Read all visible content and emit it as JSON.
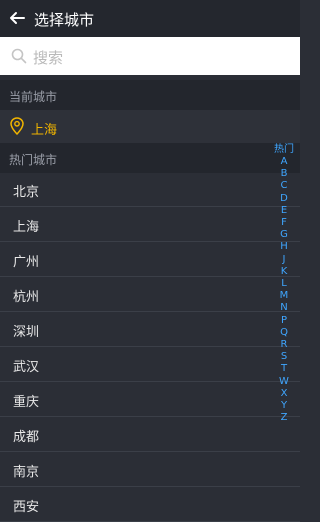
{
  "header": {
    "title": "选择城市",
    "back_icon": "arrow-left-icon"
  },
  "search": {
    "placeholder": "搜索",
    "icon": "search-icon"
  },
  "current_section": {
    "header": "当前城市",
    "city": "上海",
    "icon": "location-pin-icon"
  },
  "hot_section": {
    "header": "热门城市"
  },
  "cities": [
    "北京",
    "上海",
    "广州",
    "杭州",
    "深圳",
    "武汉",
    "重庆",
    "成都",
    "南京",
    "西安"
  ],
  "index": [
    "热门",
    "A",
    "B",
    "C",
    "D",
    "E",
    "F",
    "G",
    "H",
    "J",
    "K",
    "L",
    "M",
    "N",
    "P",
    "Q",
    "R",
    "S",
    "T",
    "W",
    "X",
    "Y",
    "Z"
  ],
  "colors": {
    "accent": "#f0b400",
    "index": "#3fa6ff",
    "background": "#2b2e36"
  }
}
